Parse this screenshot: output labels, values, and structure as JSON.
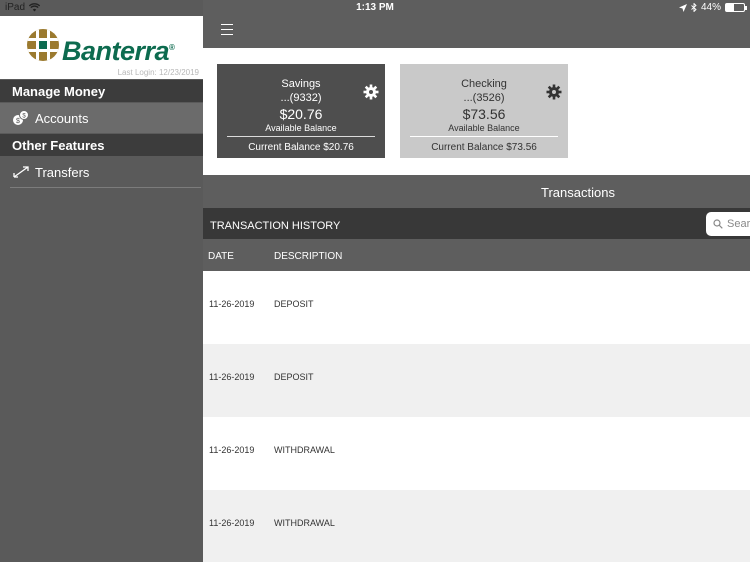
{
  "status_bar": {
    "device": "iPad",
    "time": "1:13 PM",
    "battery": "44%",
    "battery_level": 0.44
  },
  "brand": {
    "name": "Banterra",
    "registered": "®",
    "last_login": "Last Login: 12/23/2019",
    "green": "#0d6b4f",
    "gold": "#9b7a2f"
  },
  "sidebar": {
    "sections": [
      {
        "header": "Manage Money",
        "items": [
          {
            "label": "Accounts",
            "icon": "coins-icon",
            "active": true
          }
        ]
      },
      {
        "header": "Other Features",
        "items": [
          {
            "label": "Transfers",
            "icon": "transfer-arrows-icon",
            "active": false
          }
        ]
      }
    ]
  },
  "accounts": [
    {
      "name": "Savings",
      "number": "...(9332)",
      "balance": "$20.76",
      "balance_label": "Available Balance",
      "current": "Current Balance $20.76",
      "selected": true
    },
    {
      "name": "Checking",
      "number": "...(3526)",
      "balance": "$73.56",
      "balance_label": "Available Balance",
      "current": "Current Balance $73.56",
      "selected": false
    }
  ],
  "transactions": {
    "title": "Transactions",
    "history_label": "TRANSACTION HISTORY",
    "search_placeholder": "Sear",
    "columns": [
      "DATE",
      "DESCRIPTION"
    ],
    "rows": [
      {
        "date": "11-26-2019",
        "description": "DEPOSIT"
      },
      {
        "date": "11-26-2019",
        "description": "DEPOSIT"
      },
      {
        "date": "11-26-2019",
        "description": "WITHDRAWAL"
      },
      {
        "date": "11-26-2019",
        "description": "WITHDRAWAL"
      }
    ]
  }
}
